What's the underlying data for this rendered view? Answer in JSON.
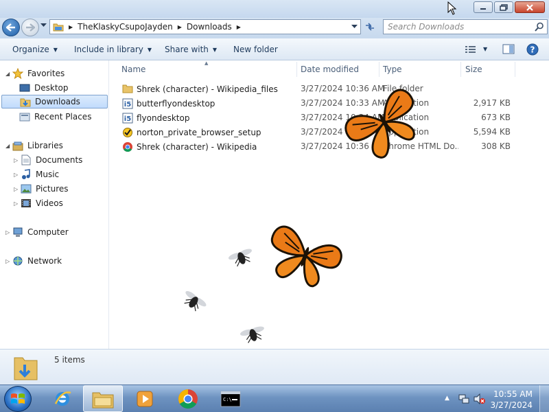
{
  "window": {
    "breadcrumb": [
      "TheKlaskyCsupoJayden",
      "Downloads"
    ],
    "search_placeholder": "Search Downloads"
  },
  "toolbar": {
    "organize": "Organize",
    "include_in_library": "Include in library",
    "share_with": "Share with",
    "new_folder": "New folder"
  },
  "nav": {
    "favorites": "Favorites",
    "desktop": "Desktop",
    "downloads": "Downloads",
    "recent_places": "Recent Places",
    "libraries": "Libraries",
    "documents": "Documents",
    "music": "Music",
    "pictures": "Pictures",
    "videos": "Videos",
    "computer": "Computer",
    "network": "Network"
  },
  "columns": {
    "name": "Name",
    "date_modified": "Date modified",
    "type": "Type",
    "size": "Size"
  },
  "files": [
    {
      "name": "Shrek (character) - Wikipedia_files",
      "date": "3/27/2024 10:36 AM",
      "type": "File folder",
      "size": "",
      "icon": "folder-icon"
    },
    {
      "name": "butterflyondesktop",
      "date": "3/27/2024 10:33 AM",
      "type": "Application",
      "size": "2,917 KB",
      "icon": "installer-icon"
    },
    {
      "name": "flyondesktop",
      "date": "3/27/2024 10:34 AM",
      "type": "Application",
      "size": "673 KB",
      "icon": "installer-icon"
    },
    {
      "name": "norton_private_browser_setup",
      "date": "3/27/2024 10:34 AM",
      "type": "Application",
      "size": "5,594 KB",
      "icon": "norton-icon"
    },
    {
      "name": "Shrek (character) - Wikipedia",
      "date": "3/27/2024 10:36 AM",
      "type": "Chrome HTML Do...",
      "size": "308 KB",
      "icon": "chrome-icon"
    }
  ],
  "details": {
    "count": "5 items"
  },
  "taskbar": {
    "time": "10:55 AM",
    "date": "3/27/2024"
  },
  "colors": {
    "selection": "#cce4fc",
    "titlebar": "#c5d8ee",
    "taskbar": "#6e93c1"
  }
}
